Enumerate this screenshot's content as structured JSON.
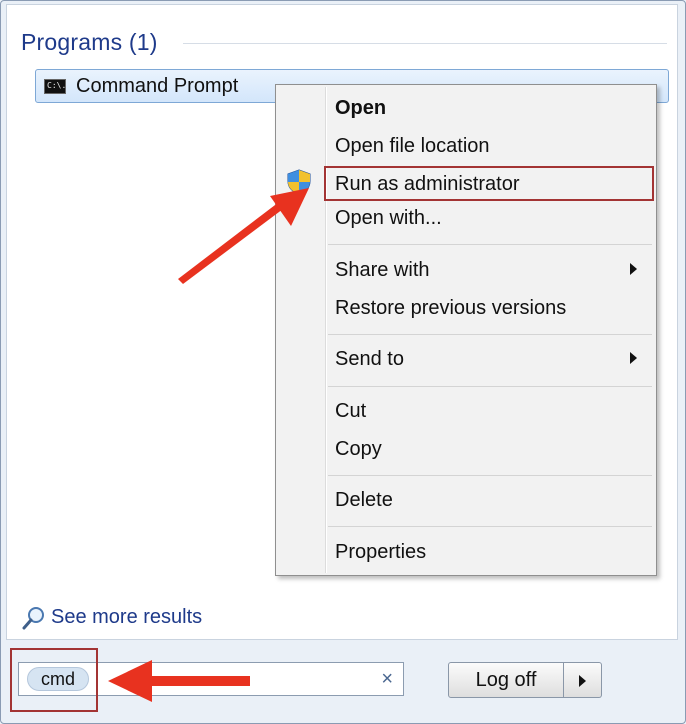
{
  "start_menu": {
    "programs_header": "Programs (1)",
    "program_item": "Command Prompt",
    "cmd_icon_text": "C:\\.",
    "see_more": "See more results",
    "search_query": "cmd",
    "clear_icon": "×",
    "logoff_label": "Log off"
  },
  "context_menu": {
    "items": [
      {
        "label": "Open",
        "bold": true
      },
      {
        "label": "Open file location"
      },
      {
        "label": "Run as administrator",
        "icon": "uac-shield-icon",
        "highlighted": true
      },
      {
        "label": "Open with..."
      },
      {
        "label": "Share with",
        "submenu": true
      },
      {
        "label": "Restore previous versions"
      },
      {
        "label": "Send to",
        "submenu": true
      },
      {
        "label": "Cut"
      },
      {
        "label": "Copy"
      },
      {
        "label": "Delete"
      },
      {
        "label": "Properties"
      }
    ]
  },
  "annotations": {
    "highlight_color": "#a33434",
    "arrow_color": "#e8321f"
  }
}
